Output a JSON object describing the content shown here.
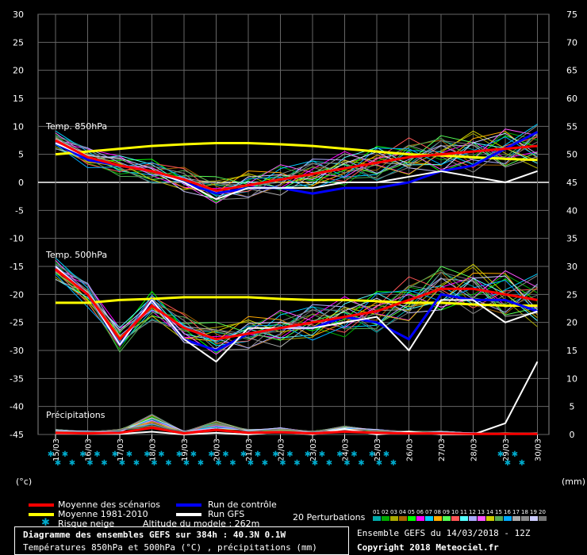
{
  "chart_data": {
    "type": "line",
    "dates": [
      "15/03",
      "16/03",
      "17/03",
      "18/03",
      "19/03",
      "20/03",
      "21/03",
      "22/03",
      "23/03",
      "24/03",
      "25/03",
      "26/03",
      "27/03",
      "28/03",
      "29/03",
      "30/03"
    ],
    "left_ticks": [
      "30",
      "25",
      "20",
      "15",
      "10",
      "5",
      "0",
      "-5",
      "-10",
      "-15",
      "-20",
      "-25",
      "-30",
      "-35",
      "-40",
      "-45"
    ],
    "right_ticks": [
      "75",
      "70",
      "65",
      "60",
      "55",
      "50",
      "45",
      "40",
      "35",
      "30",
      "25",
      "20",
      "15",
      "10",
      "5",
      "0"
    ],
    "left_unit": "(°c)",
    "right_unit": "(mm)",
    "panel_labels": {
      "t850": "Temp. 850hPa",
      "t500": "Temp. 500hPa",
      "precip": "Précipitations"
    },
    "grid": true,
    "series": {
      "t850_mean": [
        7.5,
        4.5,
        3,
        2,
        0.5,
        -1.5,
        -0.5,
        0.5,
        1.5,
        2.5,
        3.5,
        4.5,
        5,
        5.5,
        6,
        6.5
      ],
      "t850_clim": [
        5,
        5.5,
        6,
        6.5,
        6.8,
        7,
        7,
        6.8,
        6.5,
        6,
        5.5,
        5,
        4.8,
        4.5,
        4.2,
        4
      ],
      "t850_ctrl": [
        7,
        4,
        3,
        2,
        0,
        -2,
        -1,
        -1,
        -2,
        -1,
        -1,
        0,
        2,
        3,
        6,
        9
      ],
      "t850_gfs": [
        7,
        4.5,
        3,
        2,
        0,
        -3,
        -1,
        -1,
        -1,
        0,
        0,
        1,
        2,
        1,
        0,
        2
      ],
      "t500_mean": [
        -15.5,
        -20,
        -28,
        -22,
        -26,
        -28,
        -27,
        -26,
        -25,
        -24,
        -23,
        -21,
        -19,
        -19,
        -20,
        -21
      ],
      "t500_clim": [
        -21.5,
        -21.5,
        -21,
        -20.8,
        -20.5,
        -20.5,
        -20.5,
        -20.8,
        -21,
        -21,
        -21.2,
        -21.5,
        -21.5,
        -21.8,
        -22,
        -22
      ],
      "t500_ctrl": [
        -15,
        -20,
        -29,
        -21,
        -28,
        -30,
        -27,
        -26,
        -26,
        -24,
        -25,
        -28,
        -20,
        -21,
        -21,
        -23
      ],
      "t500_gfs": [
        -15,
        -20,
        -29,
        -21,
        -28,
        -32,
        -26,
        -26,
        -26,
        -25,
        -24,
        -30,
        -21,
        -21,
        -25,
        -23
      ],
      "precip_mean_mm": [
        0.3,
        0.2,
        0.3,
        1.2,
        0.2,
        0.8,
        0.3,
        0.4,
        0.2,
        0.5,
        0.3,
        0.2,
        0.2,
        0.1,
        0.1,
        0.1
      ],
      "precip_gfs_mm": [
        0.2,
        0.1,
        0.1,
        0.5,
        0,
        0.3,
        0,
        0.5,
        0,
        1,
        0,
        0.5,
        0,
        0,
        2,
        13
      ]
    },
    "snow_risk_days": [
      "15/03",
      "16/03",
      "17/03",
      "18/03",
      "19/03",
      "20/03",
      "21/03",
      "22/03",
      "23/03",
      "24/03",
      "25/03",
      "29/03"
    ]
  },
  "legend": {
    "mean": "Moyenne des scénarios",
    "clim": "Moyenne 1981-2010",
    "snow": "Risque neige",
    "ctrl": "Run de contrôle",
    "gfs": "Run GFS",
    "altitude": "Altitude du modele : 262m",
    "perturbations": "20 Perturbations",
    "pert_numbers": [
      "01",
      "02",
      "03",
      "04",
      "05",
      "06",
      "07",
      "08",
      "09",
      "10",
      "11",
      "12",
      "13",
      "14",
      "15",
      "16",
      "17",
      "18",
      "19",
      "20"
    ],
    "pert_colors": [
      "#00aaaa",
      "#00aa00",
      "#aaaa00",
      "#aa6600",
      "#00ff00",
      "#ff00ff",
      "#00ccff",
      "#ffaa00",
      "#55ff55",
      "#ff5555",
      "#55ffff",
      "#aaaaff",
      "#ff55ff",
      "#cccc00",
      "#55aa55",
      "#00aaff",
      "#aaaaaa",
      "#888888",
      "#ccccff",
      "#777777"
    ]
  },
  "footer": {
    "title": "Diagramme des ensembles GEFS sur 384h : 40.3N 0.1W",
    "subtitle": "Températures 850hPa et 500hPa (°C) , précipitations (mm)",
    "run": "Ensemble GEFS du 14/03/2018 - 12Z",
    "copyright": "Copyright 2018 Meteociel.fr"
  },
  "colors": {
    "mean": "#ff0000",
    "clim": "#ffff00",
    "ctrl": "#0000ff",
    "gfs": "#ffffff",
    "grid": "#666666",
    "snow": "#00aacc"
  }
}
